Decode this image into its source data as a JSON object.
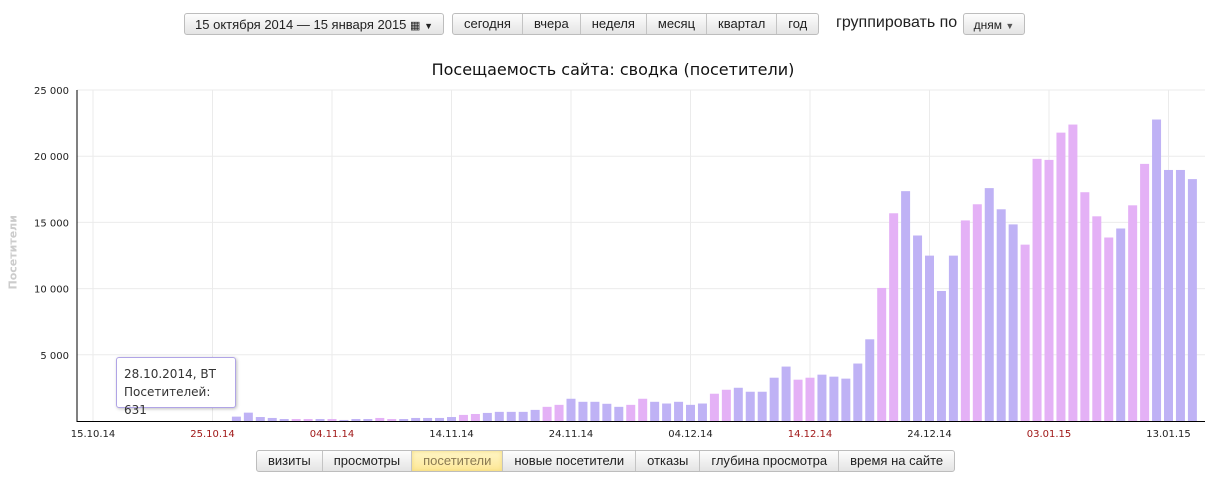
{
  "toolbar": {
    "date_range_label": "15 октября 2014 — 15 января 2015",
    "calendar_icon": "calendar-grid-icon",
    "periods": [
      "сегодня",
      "вчера",
      "неделя",
      "месяц",
      "квартал",
      "год"
    ],
    "group_by_label": "группировать по",
    "group_by_value": "дням"
  },
  "metric_tabs": {
    "items": [
      "визиты",
      "просмотры",
      "посетители",
      "новые посетители",
      "отказы",
      "глубина просмотра",
      "время на сайте"
    ],
    "active": "посетители"
  },
  "tooltip": {
    "date": "28.10.2014, ВТ",
    "value_label": "Посетителей: 631"
  },
  "chart_data": {
    "type": "bar",
    "title": "Посещаемость сайта: сводка (посетители)",
    "ylabel": "Посетители",
    "xlabel": "",
    "ylim": [
      0,
      25000
    ],
    "yticks": [
      "5 000",
      "10 000",
      "15 000",
      "20 000",
      "25 000"
    ],
    "ytick_values": [
      5000,
      10000,
      15000,
      20000,
      25000
    ],
    "axis_start_date": "2014-10-15",
    "xticks": [
      {
        "label": "15.10.14",
        "date": "2014-10-15",
        "holiday": false
      },
      {
        "label": "25.10.14",
        "date": "2014-10-25",
        "holiday": true
      },
      {
        "label": "04.11.14",
        "date": "2014-11-04",
        "holiday": true
      },
      {
        "label": "14.11.14",
        "date": "2014-11-14",
        "holiday": false
      },
      {
        "label": "24.11.14",
        "date": "2014-11-24",
        "holiday": false
      },
      {
        "label": "04.12.14",
        "date": "2014-12-04",
        "holiday": false
      },
      {
        "label": "14.12.14",
        "date": "2014-12-14",
        "holiday": true
      },
      {
        "label": "24.12.14",
        "date": "2014-12-24",
        "holiday": false
      },
      {
        "label": "03.01.15",
        "date": "2015-01-03",
        "holiday": true
      },
      {
        "label": "13.01.15",
        "date": "2015-01-13",
        "holiday": false
      }
    ],
    "first_bar_date": "2014-10-27",
    "values": [
      330,
      631,
      300,
      230,
      150,
      150,
      150,
      150,
      150,
      80,
      150,
      150,
      230,
      150,
      150,
      230,
      230,
      230,
      300,
      460,
      530,
      610,
      690,
      690,
      690,
      840,
      1070,
      1220,
      1680,
      1450,
      1450,
      1300,
      1070,
      1220,
      1680,
      1450,
      1320,
      1450,
      1220,
      1320,
      2060,
      2360,
      2510,
      2210,
      2210,
      3270,
      4110,
      3120,
      3270,
      3500,
      3350,
      3200,
      4340,
      6170,
      10050,
      15690,
      17360,
      14010,
      12490,
      9820,
      12490,
      15150,
      16370,
      17590,
      15990,
      14850,
      13320,
      19800,
      19720,
      21780,
      22390,
      17280,
      15460,
      13860,
      14540,
      16290,
      19420,
      22770,
      18960,
      18960,
      18270
    ],
    "holiday_dates": [
      "2014-11-01",
      "2014-11-02",
      "2014-11-04",
      "2014-11-08",
      "2014-11-09",
      "2014-11-15",
      "2014-11-16",
      "2014-11-22",
      "2014-11-23",
      "2014-11-29",
      "2014-11-30",
      "2014-12-06",
      "2014-12-07",
      "2014-12-13",
      "2014-12-14",
      "2014-12-20",
      "2014-12-21",
      "2014-12-27",
      "2014-12-28",
      "2015-01-01",
      "2015-01-02",
      "2015-01-03",
      "2015-01-04",
      "2015-01-05",
      "2015-01-06",
      "2015-01-07",
      "2015-01-08",
      "2015-01-10",
      "2015-01-11"
    ],
    "colors": {
      "workday": "#bfb2f5",
      "holiday": "#e4b1f6",
      "holiday_tick": "#a01818"
    },
    "grid": true
  }
}
